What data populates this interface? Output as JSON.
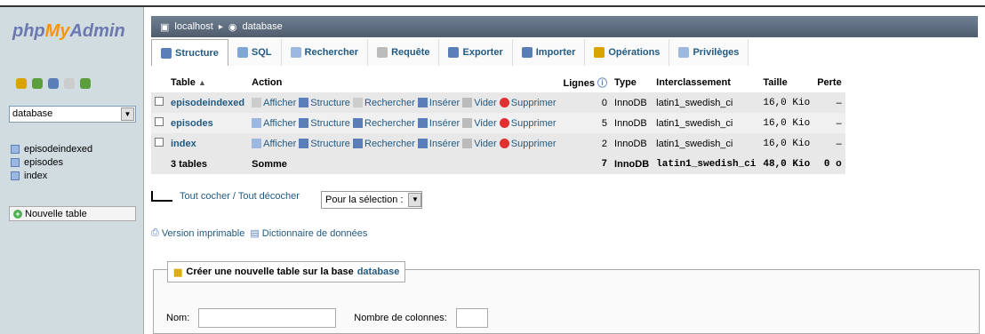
{
  "logo": {
    "php": "php",
    "my": "My",
    "admin": "Admin"
  },
  "sidebar": {
    "selected_db": "database",
    "tables": [
      "episodeindexed",
      "episodes",
      "index"
    ],
    "new_table": "Nouvelle table",
    "icons": [
      "home-icon",
      "db-icon",
      "info-icon",
      "doc-icon",
      "reload-icon"
    ]
  },
  "breadcrumb": {
    "server": "localhost",
    "sep": "▸",
    "db": "database"
  },
  "tabs": [
    {
      "label": "Structure"
    },
    {
      "label": "SQL"
    },
    {
      "label": "Rechercher"
    },
    {
      "label": "Requête"
    },
    {
      "label": "Exporter"
    },
    {
      "label": "Importer"
    },
    {
      "label": "Opérations"
    },
    {
      "label": "Privilèges"
    }
  ],
  "table": {
    "headers": {
      "table": "Table",
      "action": "Action",
      "lignes": "Lignes",
      "type": "Type",
      "interclassement": "Interclassement",
      "taille": "Taille",
      "perte": "Perte"
    },
    "actions": {
      "afficher": "Afficher",
      "structure": "Structure",
      "rechercher": "Rechercher",
      "inserer": "Insérer",
      "vider": "Vider",
      "supprimer": "Supprimer"
    },
    "rows": [
      {
        "name": "episodeindexed",
        "lignes": "0",
        "type": "InnoDB",
        "collation": "latin1_swedish_ci",
        "taille": "16,0 Kio",
        "perte": "–"
      },
      {
        "name": "episodes",
        "lignes": "5",
        "type": "InnoDB",
        "collation": "latin1_swedish_ci",
        "taille": "16,0 Kio",
        "perte": "–"
      },
      {
        "name": "index",
        "lignes": "2",
        "type": "InnoDB",
        "collation": "latin1_swedish_ci",
        "taille": "16,0 Kio",
        "perte": "–"
      }
    ],
    "summary": {
      "tables": "3 tables",
      "somme": "Somme",
      "lignes": "7",
      "type": "InnoDB",
      "collation": "latin1_swedish_ci",
      "taille": "48,0 Kio",
      "perte": "0 o"
    }
  },
  "checkall": "Tout cocher / Tout décocher",
  "for_selection": "Pour la sélection :",
  "links": {
    "print": "Version imprimable",
    "dict": "Dictionnaire de données"
  },
  "create": {
    "legend": "Créer une nouvelle table sur la base",
    "db": "database",
    "name_label": "Nom:",
    "cols_label": "Nombre de colonnes:"
  }
}
